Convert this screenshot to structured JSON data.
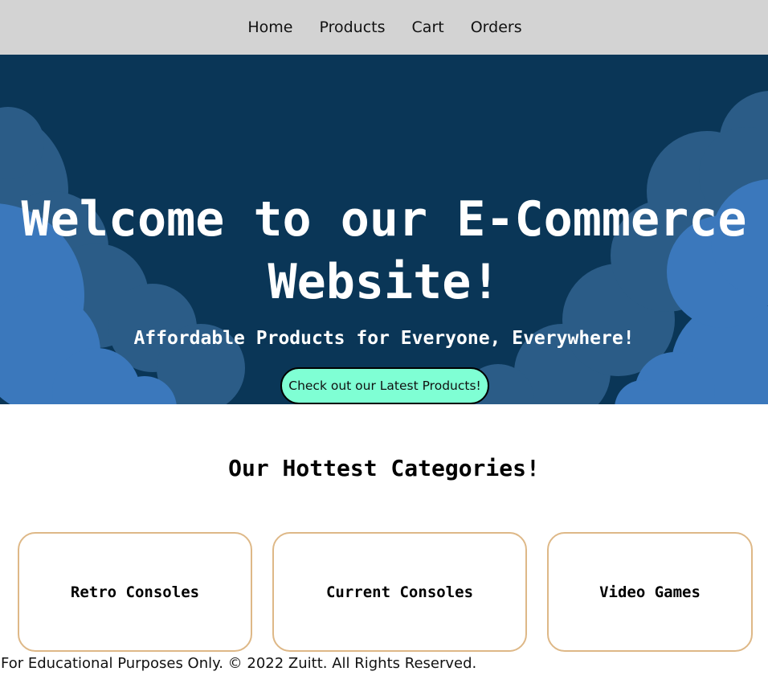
{
  "nav": {
    "items": [
      {
        "label": "Home"
      },
      {
        "label": "Products"
      },
      {
        "label": "Cart"
      },
      {
        "label": "Orders"
      }
    ]
  },
  "hero": {
    "title_line1": "Welcome to our E-Commerce",
    "title_line2": "Website!",
    "subtitle": "Affordable Products for Everyone, Everywhere!",
    "cta_label": "Check out our Latest Products!"
  },
  "categories": {
    "heading": "Our Hottest Categories!",
    "items": [
      {
        "label": "Retro Consoles"
      },
      {
        "label": "Current Consoles"
      },
      {
        "label": "Video Games"
      }
    ]
  },
  "footer": {
    "text": "For Educational Purposes Only. © 2022 Zuitt. All Rights Reserved."
  },
  "colors": {
    "navbar_bg": "#d3d3d3",
    "hero_bg": "#0a3657",
    "cloud_dark": "#2b5c87",
    "cloud_light": "#3b78bc",
    "cta_bg": "#7fffd4",
    "card_border": "#deb887"
  }
}
